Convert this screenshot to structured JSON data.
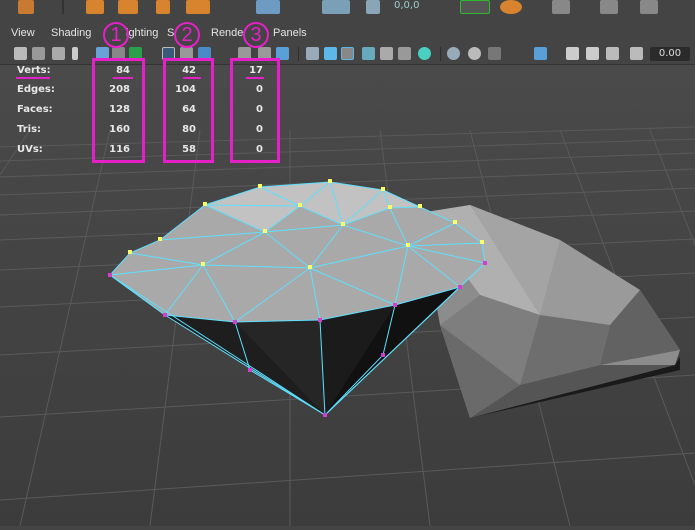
{
  "menu": {
    "view": "View",
    "shading": "Shading",
    "lighting": "ighting",
    "show": "S",
    "renderer": "Rende",
    "panels": "Panels"
  },
  "toolbar": {
    "coords_label": "0,0,0",
    "zoom_value": "0.00"
  },
  "hud": {
    "rows": [
      {
        "label": "Verts:",
        "col1": "84",
        "col2": "42",
        "col3": "17"
      },
      {
        "label": "Edges:",
        "col1": "208",
        "col2": "104",
        "col3": "0"
      },
      {
        "label": "Faces:",
        "col1": "128",
        "col2": "64",
        "col3": "0"
      },
      {
        "label": "Tris:",
        "col1": "160",
        "col2": "80",
        "col3": "0"
      },
      {
        "label": "UVs:",
        "col1": "116",
        "col2": "58",
        "col3": "0"
      }
    ]
  },
  "annotations": {
    "callout_1": "1",
    "callout_2": "2",
    "callout_3": "3",
    "color": "#e620c8"
  },
  "colors": {
    "wireframe": "#5ee0ff",
    "vertex_selected": "#ffff66",
    "vertex_unselected": "#e040e0",
    "background": "#444444",
    "grid": "#555555"
  }
}
